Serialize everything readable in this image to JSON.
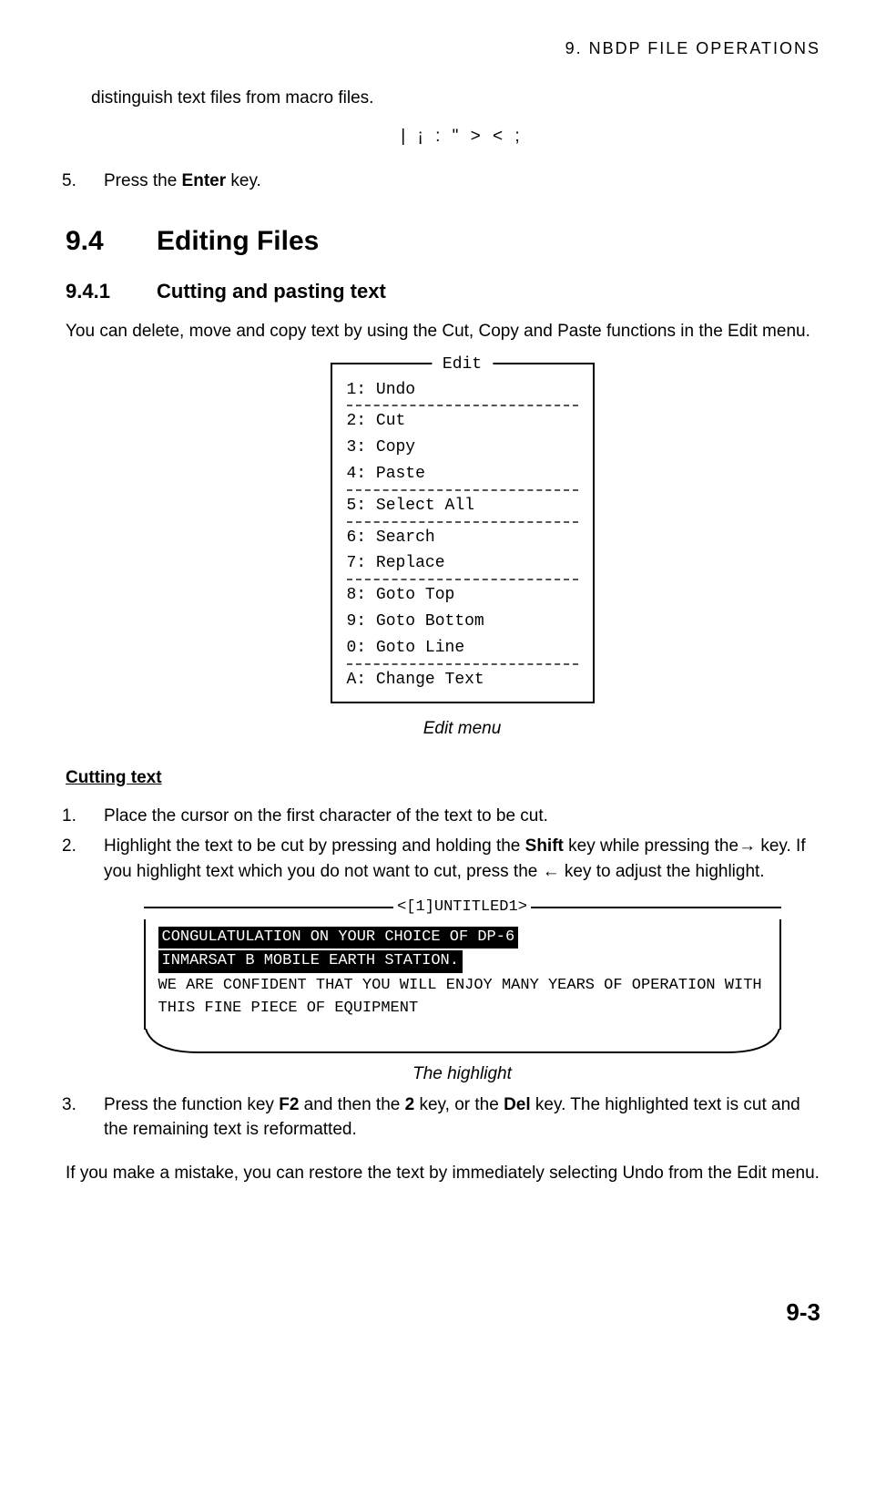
{
  "chapter_header": "9.  NBDP  FILE  OPERATIONS",
  "para_distinguish": "distinguish text files from macro files.",
  "special_chars": "|  ¡  :  \"  >  <  ;",
  "step5_num": "5.",
  "step5_a": "Press the ",
  "step5_bold": "Enter",
  "step5_b": " key.",
  "sec94_num": "9.4",
  "sec94_title": "Editing Files",
  "sec941_num": "9.4.1",
  "sec941_title": "Cutting and pasting text",
  "sec941_intro": "You can delete, move and copy text by using the Cut, Copy and Paste functions in the Edit menu.",
  "edit_menu": {
    "title": "Edit",
    "i1": "1: Undo",
    "i2": "2: Cut",
    "i3": "3: Copy",
    "i4": "4: Paste",
    "i5": "5: Select All",
    "i6": "6: Search",
    "i7": "7: Replace",
    "i8": "8: Goto Top",
    "i9": "9: Goto Bottom",
    "i0": "0: Goto Line",
    "iA": "A: Change Text",
    "caption": "Edit menu"
  },
  "cutting_heading": "Cutting text",
  "cut_step1_num": "1.",
  "cut_step1": "Place the cursor on the first character of the text to be cut.",
  "cut_step2_num": "2.",
  "cut_step2_a": "Highlight the text to be cut by pressing and holding the ",
  "cut_step2_bold": "Shift",
  "cut_step2_b": " key while pressing the→ key. If you highlight text which you do not want to cut, press the ← key to adjust the highlight.",
  "highlight": {
    "title": "<[1]UNTITLED1>",
    "hl1": "CONGULATULATION ON YOUR CHOICE OF DP-6 ",
    "hl2": "INMARSAT B MOBILE EARTH STATION.",
    "plain": "WE ARE CONFIDENT THAT YOU WILL ENJOY MANY YEARS OF OPERATION WITH THIS FINE PIECE OF EQUIPMENT",
    "caption": "The highlight"
  },
  "cut_step3_num": "3.",
  "cut_step3_a": "Press the function key ",
  "cut_step3_b1": "F2",
  "cut_step3_c": " and then the ",
  "cut_step3_b2": "2",
  "cut_step3_d": " key, or the ",
  "cut_step3_b3": "Del",
  "cut_step3_e": " key. The highlighted text is cut and the remaining text is reformatted.",
  "undo_note": "If you make a mistake, you can restore the text by immediately selecting Undo from the Edit menu.",
  "page_number": "9-3"
}
